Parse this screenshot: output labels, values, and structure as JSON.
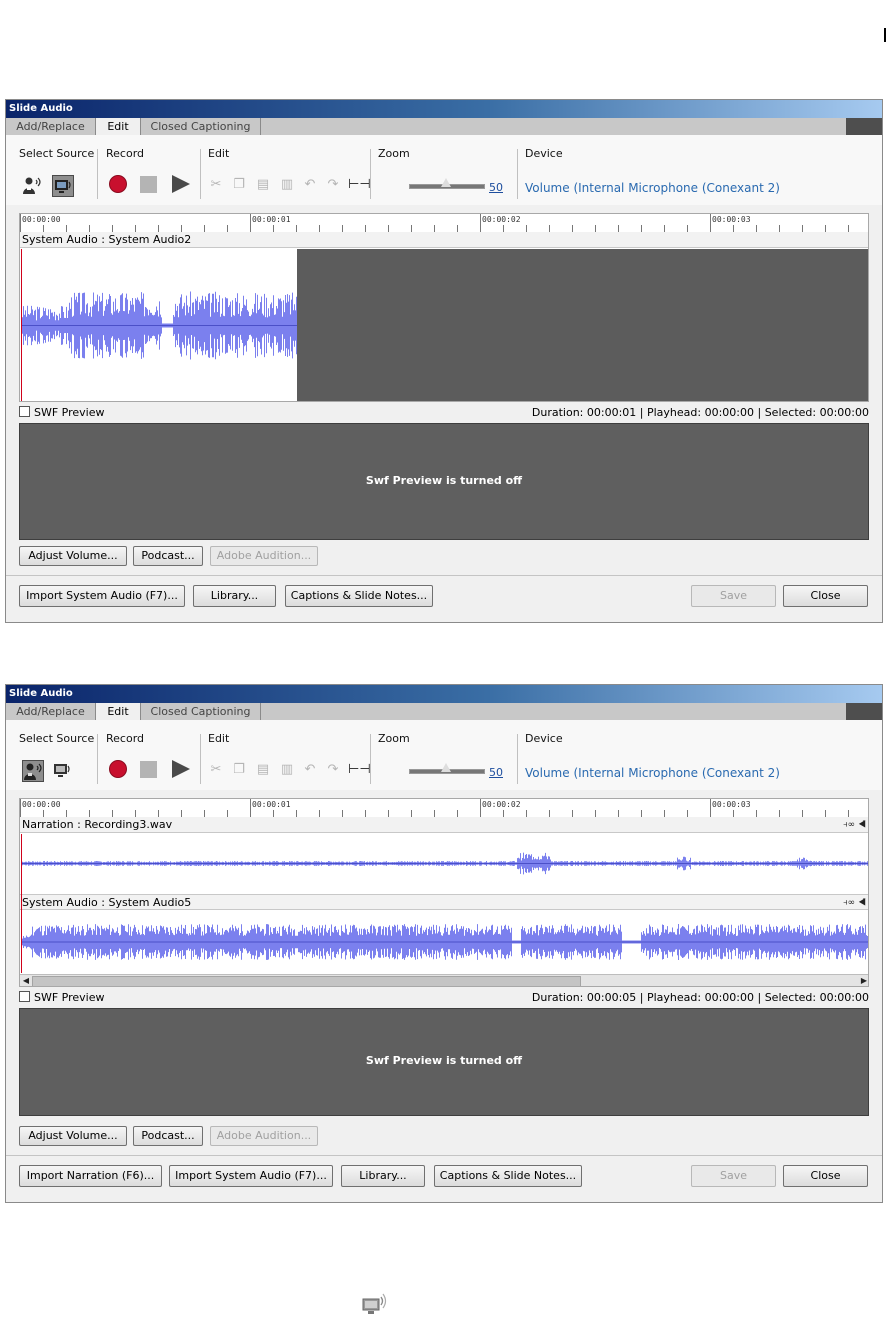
{
  "dialog_title": "Slide Audio",
  "tabs": [
    "Add/Replace",
    "Edit",
    "Closed Captioning"
  ],
  "toolbar": {
    "select_source_label": "Select Source",
    "record_label": "Record",
    "edit_label": "Edit",
    "zoom_label": "Zoom",
    "zoom_value": "50",
    "device_label": "Device",
    "device_value": "Volume (Internal Microphone (Conexant 2)"
  },
  "ruler_labels": [
    "00:00:00",
    "00:00:01",
    "00:00:02",
    "00:00:03"
  ],
  "dialog1": {
    "track1_title": "System Audio : System Audio2",
    "swf_preview_label": "SWF Preview",
    "status_text": "Duration:  00:00:01 | Playhead:  00:00:00 | Selected:  00:00:00",
    "preview_message": "Swf Preview is turned off",
    "adjust_volume": "Adjust Volume...",
    "podcast": "Podcast...",
    "adobe_audition": "Adobe Audition...",
    "import_system_audio": "Import System Audio (F7)...",
    "library": "Library...",
    "captions_notes": "Captions & Slide Notes...",
    "save": "Save",
    "close": "Close",
    "selected_source": "system-audio"
  },
  "dialog2": {
    "track1_title": "Narration : Recording3.wav",
    "track2_title": "System Audio : System Audio5",
    "swf_preview_label": "SWF Preview",
    "status_text": "Duration:  00:00:05 | Playhead:  00:00:00 | Selected:  00:00:00",
    "preview_message": "Swf Preview is turned off",
    "adjust_volume": "Adjust Volume...",
    "podcast": "Podcast...",
    "adobe_audition": "Adobe Audition...",
    "import_narration": "Import Narration (F6)...",
    "import_system_audio": "Import System Audio (F7)...",
    "library": "Library...",
    "captions_notes": "Captions & Slide Notes...",
    "save": "Save",
    "close": "Close",
    "selected_source": "narration"
  },
  "colors": {
    "waveform": "#7b80ee",
    "record": "#c8102e",
    "device_link": "#2a6ab0",
    "preview_bg": "#5f5f5f"
  },
  "icons": [
    "narration-source-icon",
    "system-audio-source-icon",
    "record-icon",
    "stop-icon",
    "play-icon",
    "cut-icon",
    "copy-icon",
    "paste-icon",
    "delete-icon",
    "undo-icon",
    "redo-icon",
    "insert-silence-icon",
    "track-settings-icon",
    "mute-icon",
    "system-audio-monitor-icon"
  ]
}
